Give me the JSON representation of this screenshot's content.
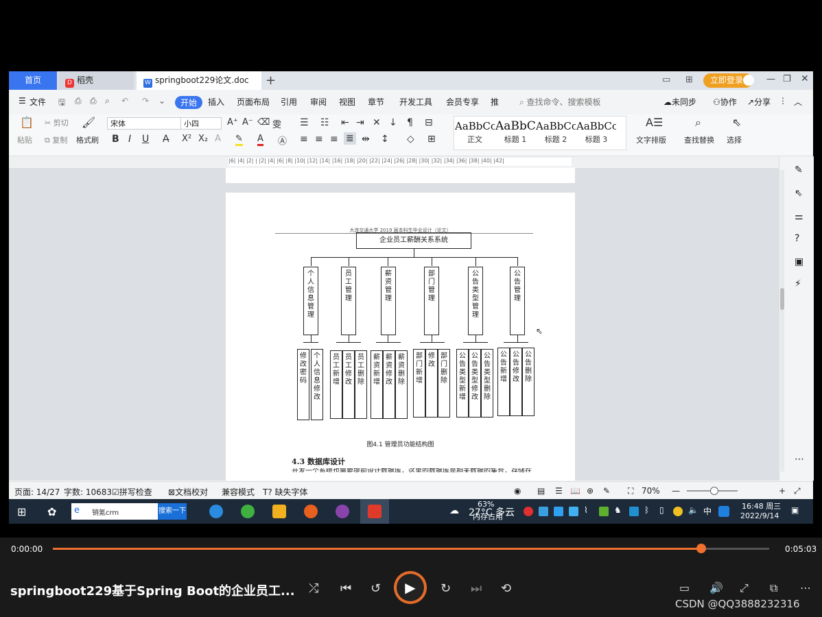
{
  "tabs": {
    "home": "首页",
    "docer": "稻壳",
    "doc": "springboot229论文.doc",
    "add": "+"
  },
  "titlebar": {
    "login": "立即登录"
  },
  "menus": {
    "file": "文件",
    "start": "开始",
    "insert": "插入",
    "layout": "页面布局",
    "ref": "引用",
    "review": "审阅",
    "view": "视图",
    "chapter": "章节",
    "dev": "开发工具",
    "vip": "会员专享",
    "more": "推",
    "search": "查找命令、搜索模板",
    "unsync": "未同步",
    "collab": "协作",
    "share": "分享"
  },
  "ribbon": {
    "paste": "粘贴",
    "cut": "剪切",
    "copy": "复制",
    "format_painter": "格式刷",
    "font_name": "宋体",
    "font_size": "小四",
    "styles": [
      {
        "sample": "AaBbCcI",
        "name": "正文"
      },
      {
        "sample": "AaBbC",
        "name": "标题 1"
      },
      {
        "sample": "AaBbCc",
        "name": "标题 2"
      },
      {
        "sample": "AaBbCc",
        "name": "标题 3"
      }
    ],
    "text_layout": "文字排版",
    "find_replace": "查找替换",
    "select": "选择"
  },
  "ruler": "|6| |4| |2| | |2| |4| |6| |8| |10| |12| |14| |16| |18| |20| |22| |24| |26| |28| |30| |32| |34| |36| |38| |40| |42|",
  "document": {
    "header": "大连交通大学 2019 届本科生毕业设计（论文）",
    "root": "企业员工薪酬关系系统",
    "modules": [
      {
        "name": "个人信息管理",
        "children": [
          "修改密码",
          "个人信息修改"
        ]
      },
      {
        "name": "员工管理",
        "children": [
          "员工新增",
          "员工修改",
          "员工删除"
        ]
      },
      {
        "name": "薪资管理",
        "children": [
          "薪资新增",
          "薪资修改",
          "薪资删除"
        ]
      },
      {
        "name": "部门管理",
        "children": [
          "部门新增",
          "修改",
          "部门删除"
        ]
      },
      {
        "name": "公告类型管理",
        "children": [
          "公告类型新增",
          "公告类型修改",
          "公告类型删除"
        ]
      },
      {
        "name": "公告管理",
        "children": [
          "公告新增",
          "公告修改",
          "公告删除"
        ]
      }
    ],
    "caption": "图4.1 管理员功能结构图",
    "section": "4.3  数据库设计",
    "body_fragment": "开发一个系统也需要提前设计数据库，这里的数据库是相关数据的集合，存储在"
  },
  "status": {
    "page": "页面: 14/27",
    "words": "字数: 10683",
    "spell": "拼写检查",
    "proof": "文档校对",
    "compat": "兼容模式",
    "missing_font": "缺失字体",
    "zoom": "70%"
  },
  "taskbar": {
    "search_text": "销氪crm",
    "search_btn": "搜索一下",
    "weather": "27°C 多云",
    "mem": "63%",
    "mem_label": "内存占用",
    "ime": "中",
    "time": "16:48 周三",
    "date": "2022/9/14"
  },
  "player": {
    "elapsed": "0:00:00",
    "duration": "0:05:03",
    "progress": 0.905,
    "title": "springboot229基于Spring Boot的企业员工...",
    "watermark": "CSDN @QQ3888232316"
  }
}
